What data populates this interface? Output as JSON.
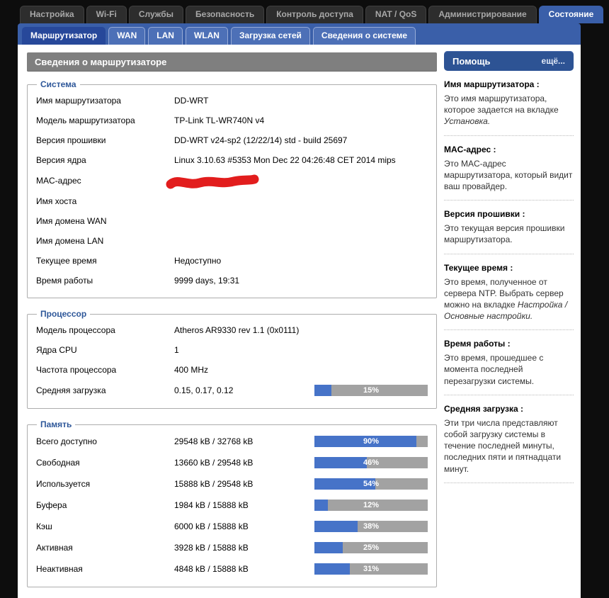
{
  "page_title": "Сведения о маршрутизаторе",
  "nav": {
    "tabs": [
      {
        "name": "setup",
        "label": "Настройка",
        "active": false
      },
      {
        "name": "wifi",
        "label": "Wi-Fi",
        "active": false
      },
      {
        "name": "services",
        "label": "Службы",
        "active": false
      },
      {
        "name": "security",
        "label": "Безопасность",
        "active": false
      },
      {
        "name": "access-restrictions",
        "label": "Контроль доступа",
        "active": false
      },
      {
        "name": "nat-qos",
        "label": "NAT / QoS",
        "active": false
      },
      {
        "name": "administration",
        "label": "Администрирование",
        "active": false
      },
      {
        "name": "status",
        "label": "Состояние",
        "active": true
      }
    ],
    "subtabs": [
      {
        "name": "router",
        "label": "Маршрутизатор",
        "active": true
      },
      {
        "name": "wan",
        "label": "WAN",
        "active": false
      },
      {
        "name": "lan",
        "label": "LAN",
        "active": false
      },
      {
        "name": "wlan",
        "label": "WLAN",
        "active": false
      },
      {
        "name": "bandwidth",
        "label": "Загрузка сетей",
        "active": false
      },
      {
        "name": "sysinfo",
        "label": "Сведения о системе",
        "active": false
      }
    ]
  },
  "sections": {
    "system": {
      "legend": "Система",
      "rows": [
        {
          "label": "Имя маршрутизатора",
          "value": "DD-WRT"
        },
        {
          "label": "Модель маршрутизатора",
          "value": "TP-Link TL-WR740N v4"
        },
        {
          "label": "Версия прошивки",
          "value": "DD-WRT v24-sp2 (12/22/14) std - build 25697"
        },
        {
          "label": "Версия ядра",
          "value": "Linux 3.10.63 #5353 Mon Dec 22 04:26:48 CET 2014 mips"
        },
        {
          "label": "MAC-адрес",
          "value": "",
          "redacted": true
        },
        {
          "label": "Имя хоста",
          "value": ""
        },
        {
          "label": "Имя домена WAN",
          "value": ""
        },
        {
          "label": "Имя домена LAN",
          "value": ""
        },
        {
          "label": "Текущее время",
          "value": "Недоступно"
        },
        {
          "label": "Время работы",
          "value": "9999 days, 19:31"
        }
      ]
    },
    "cpu": {
      "legend": "Процессор",
      "rows": [
        {
          "label": "Модель процессора",
          "value": "Atheros AR9330 rev 1.1 (0x0111)"
        },
        {
          "label": "Ядра CPU",
          "value": "1"
        },
        {
          "label": "Частота процессора",
          "value": "400 MHz"
        },
        {
          "label": "Средняя загрузка",
          "value": "0.15, 0.17, 0.12",
          "percent": 15
        }
      ]
    },
    "memory": {
      "legend": "Память",
      "rows": [
        {
          "label": "Всего доступно",
          "value": "29548 kB / 32768 kB",
          "percent": 90
        },
        {
          "label": "Свободная",
          "value": "13660 kB / 29548 kB",
          "percent": 46
        },
        {
          "label": "Используется",
          "value": "15888 kB / 29548 kB",
          "percent": 54
        },
        {
          "label": "Буфера",
          "value": "1984 kB / 15888 kB",
          "percent": 12
        },
        {
          "label": "Кэш",
          "value": "6000 kB / 15888 kB",
          "percent": 38
        },
        {
          "label": "Активная",
          "value": "3928 kB / 15888 kB",
          "percent": 25
        },
        {
          "label": "Неактивная",
          "value": "4848 kB / 15888 kB",
          "percent": 31
        }
      ]
    }
  },
  "help": {
    "title": "Помощь",
    "more_label": "ещё...",
    "topics": [
      {
        "heading": "Имя маршрутизатора :",
        "parts": [
          {
            "text": "Это имя маршрутизатора, которое задается на вкладке "
          },
          {
            "text": "Установка.",
            "italic": true
          }
        ]
      },
      {
        "heading": "MAC-адрес :",
        "parts": [
          {
            "text": "Это MAC-адрес маршрутизатора, который видит ваш провайдер."
          }
        ]
      },
      {
        "heading": "Версия прошивки :",
        "parts": [
          {
            "text": "Это текущая версия прошивки маршрутизатора."
          }
        ]
      },
      {
        "heading": "Текущее время :",
        "parts": [
          {
            "text": "Это время, полученное от сервера NTP. Выбрать сервер можно на вкладке "
          },
          {
            "text": "Настройка / Основные настройки.",
            "italic": true
          }
        ]
      },
      {
        "heading": "Время работы :",
        "parts": [
          {
            "text": "Это время, прошедшее с момента последней перезагрузки системы."
          }
        ]
      },
      {
        "heading": "Средняя загрузка :",
        "parts": [
          {
            "text": "Эти три числа представляют собой загрузку системы в течение последней минуты, последних пяти и пятнадцати минут."
          }
        ]
      }
    ]
  },
  "colors": {
    "accent_blue": "#3a5fa9",
    "subtab_blue": "#4d70b7",
    "active_subtab_blue": "#27489a",
    "help_header_blue": "#2d5394",
    "title_bar_gray": "#7f7f7f",
    "bar_track": "#a2a2a2",
    "bar_fill": "#4673c8",
    "redaction_red": "#e21d1d",
    "section_legend_blue": "#2e5799"
  }
}
